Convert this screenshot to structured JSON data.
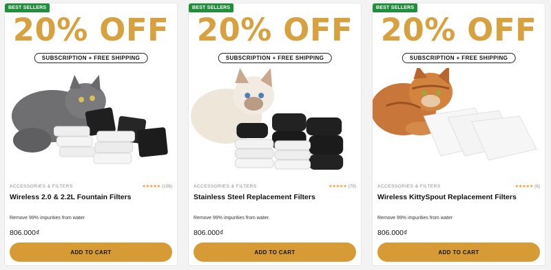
{
  "products": [
    {
      "badge": "BEST SELLERS",
      "promo": "20% OFF",
      "pill": "SUBSCRIPTION + FREE SHIPPING",
      "category": "ACCESSORIES & FILTERS",
      "stars": "★★★★★",
      "reviews": "(108)",
      "title": "Wireless 2.0 & 2.2L Fountain Filters",
      "description": "Remove 99% impurities from water",
      "price": "806.000₫",
      "cta": "ADD TO CART",
      "image": "grey-cat-with-black-and-white-filters"
    },
    {
      "badge": "BEST SELLERS",
      "promo": "20% OFF",
      "pill": "SUBSCRIPTION + FREE SHIPPING",
      "category": "ACCESSORIES & FILTERS",
      "stars": "★★★★★",
      "reviews": "(79)",
      "title": "Stainless Steel Replacement Filters",
      "description": "Remove 99% impurities from water.",
      "price": "806.000₫",
      "cta": "ADD TO CART",
      "image": "cream-kitten-with-foam-filters"
    },
    {
      "badge": "BEST SELLERS",
      "promo": "20% OFF",
      "pill": "SUBSCRIPTION + FREE SHIPPING",
      "category": "ACCESSORIES & FILTERS",
      "stars": "★★★★★",
      "reviews": "(6)",
      "title": "Wireless KittySpout Replacement Filters",
      "description": "Remove 99% impurities from water",
      "price": "806.000₫",
      "cta": "ADD TO CART",
      "image": "orange-tabby-with-white-filters"
    }
  ],
  "colors": {
    "accent": "#d79b36",
    "promo": "#d7a140",
    "badge": "#1f8f3a",
    "stars": "#e8a13b"
  }
}
